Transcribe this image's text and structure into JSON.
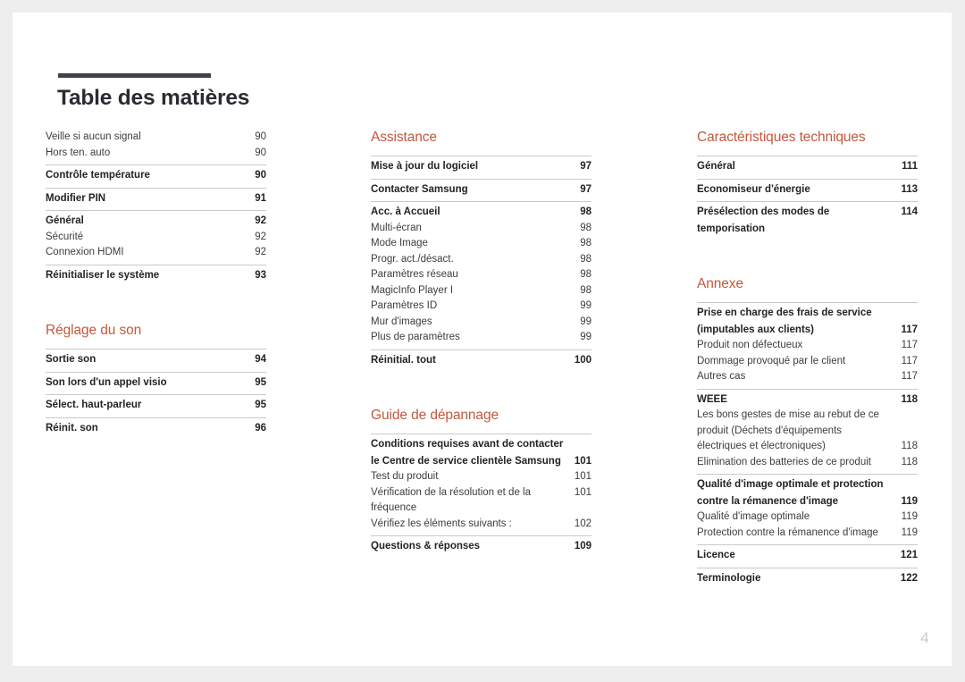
{
  "document": {
    "title": "Table des matières",
    "page_number": "4",
    "accent_color": "#c2583c",
    "rule_color": "#433f4d",
    "divider_color": "#c9c9c9"
  },
  "columns": [
    {
      "name": "column-left",
      "sections": [
        {
          "heading": null,
          "groups": [
            {
              "top_rule": false,
              "entries": [
                {
                  "label": "Veille si aucun signal",
                  "page": "90",
                  "level": "minor"
                },
                {
                  "label": "Hors ten. auto",
                  "page": "90",
                  "level": "minor"
                }
              ]
            },
            {
              "top_rule": true,
              "entries": [
                {
                  "label": "Contrôle température",
                  "page": "90",
                  "level": "major"
                }
              ]
            },
            {
              "top_rule": true,
              "entries": [
                {
                  "label": "Modifier PIN",
                  "page": "91",
                  "level": "major"
                }
              ]
            },
            {
              "top_rule": true,
              "entries": [
                {
                  "label": "Général",
                  "page": "92",
                  "level": "major"
                },
                {
                  "label": "Sécurité",
                  "page": "92",
                  "level": "minor"
                },
                {
                  "label": "Connexion HDMI",
                  "page": "92",
                  "level": "minor"
                }
              ]
            },
            {
              "top_rule": true,
              "entries": [
                {
                  "label": "Réinitialiser le système",
                  "page": "93",
                  "level": "major"
                }
              ]
            }
          ]
        },
        {
          "heading": "Réglage du son",
          "groups": [
            {
              "top_rule": true,
              "entries": [
                {
                  "label": "Sortie son",
                  "page": "94",
                  "level": "major"
                }
              ]
            },
            {
              "top_rule": true,
              "entries": [
                {
                  "label": "Son lors d'un appel visio",
                  "page": "95",
                  "level": "major"
                }
              ]
            },
            {
              "top_rule": true,
              "entries": [
                {
                  "label": "Sélect. haut-parleur",
                  "page": "95",
                  "level": "major"
                }
              ]
            },
            {
              "top_rule": true,
              "entries": [
                {
                  "label": "Réinit. son",
                  "page": "96",
                  "level": "major"
                }
              ]
            }
          ]
        }
      ]
    },
    {
      "name": "column-middle",
      "sections": [
        {
          "heading": "Assistance",
          "groups": [
            {
              "top_rule": true,
              "entries": [
                {
                  "label": "Mise à jour du logiciel",
                  "page": "97",
                  "level": "major"
                }
              ]
            },
            {
              "top_rule": true,
              "entries": [
                {
                  "label": "Contacter Samsung",
                  "page": "97",
                  "level": "major"
                }
              ]
            },
            {
              "top_rule": true,
              "entries": [
                {
                  "label": "Acc. à Accueil",
                  "page": "98",
                  "level": "major"
                },
                {
                  "label": "Multi-écran",
                  "page": "98",
                  "level": "minor"
                },
                {
                  "label": "Mode Image",
                  "page": "98",
                  "level": "minor"
                },
                {
                  "label": "Progr. act./désact.",
                  "page": "98",
                  "level": "minor"
                },
                {
                  "label": "Paramètres réseau",
                  "page": "98",
                  "level": "minor"
                },
                {
                  "label": "MagicInfo Player I",
                  "page": "98",
                  "level": "minor"
                },
                {
                  "label": "Paramètres ID",
                  "page": "99",
                  "level": "minor"
                },
                {
                  "label": "Mur d'images",
                  "page": "99",
                  "level": "minor"
                },
                {
                  "label": "Plus de paramètres",
                  "page": "99",
                  "level": "minor"
                }
              ]
            },
            {
              "top_rule": true,
              "entries": [
                {
                  "label": "Réinitial. tout",
                  "page": "100",
                  "level": "major"
                }
              ]
            }
          ]
        },
        {
          "heading": "Guide de dépannage",
          "groups": [
            {
              "top_rule": true,
              "entries": [
                {
                  "label": "Conditions requises avant de contacter le Centre de service clientèle Samsung",
                  "page": "101",
                  "level": "major",
                  "wrap": true
                },
                {
                  "label": "Test du produit",
                  "page": "101",
                  "level": "minor"
                },
                {
                  "label": "Vérification de la résolution et de la fréquence",
                  "page": "101",
                  "level": "minor"
                },
                {
                  "label": "Vérifiez les éléments suivants :",
                  "page": "102",
                  "level": "minor"
                }
              ]
            },
            {
              "top_rule": true,
              "entries": [
                {
                  "label": "Questions & réponses",
                  "page": "109",
                  "level": "major"
                }
              ]
            }
          ]
        }
      ]
    },
    {
      "name": "column-right",
      "sections": [
        {
          "heading": "Caractéristiques techniques",
          "groups": [
            {
              "top_rule": true,
              "entries": [
                {
                  "label": "Général",
                  "page": "111",
                  "level": "major"
                }
              ]
            },
            {
              "top_rule": true,
              "entries": [
                {
                  "label": "Economiseur d'énergie",
                  "page": "113",
                  "level": "major"
                }
              ]
            },
            {
              "top_rule": true,
              "entries": [
                {
                  "label": "Présélection des modes de temporisation",
                  "page": "114",
                  "level": "major"
                }
              ]
            }
          ]
        },
        {
          "heading": "Annexe",
          "groups": [
            {
              "top_rule": true,
              "entries": [
                {
                  "label": "Prise en charge des frais de service (imputables aux clients)",
                  "page": "117",
                  "level": "major",
                  "wrap": true
                },
                {
                  "label": "Produit non défectueux",
                  "page": "117",
                  "level": "minor"
                },
                {
                  "label": "Dommage provoqué par le client",
                  "page": "117",
                  "level": "minor"
                },
                {
                  "label": "Autres cas",
                  "page": "117",
                  "level": "minor"
                }
              ]
            },
            {
              "top_rule": true,
              "entries": [
                {
                  "label": "WEEE",
                  "page": "118",
                  "level": "major"
                },
                {
                  "label": "Les bons gestes de mise au rebut de ce produit (Déchets d'équipements électriques et électroniques)",
                  "page": "118",
                  "level": "minor",
                  "wrap": true
                },
                {
                  "label": "Elimination des batteries de ce produit",
                  "page": "118",
                  "level": "minor"
                }
              ]
            },
            {
              "top_rule": true,
              "entries": [
                {
                  "label": "Qualité d'image optimale et protection contre la rémanence d'image",
                  "page": "119",
                  "level": "major",
                  "wrap": true
                },
                {
                  "label": "Qualité d'image optimale",
                  "page": "119",
                  "level": "minor"
                },
                {
                  "label": "Protection contre la rémanence d'image",
                  "page": "119",
                  "level": "minor"
                }
              ]
            },
            {
              "top_rule": true,
              "entries": [
                {
                  "label": "Licence",
                  "page": "121",
                  "level": "major"
                }
              ]
            },
            {
              "top_rule": true,
              "entries": [
                {
                  "label": "Terminologie",
                  "page": "122",
                  "level": "major"
                }
              ]
            }
          ]
        }
      ]
    }
  ]
}
